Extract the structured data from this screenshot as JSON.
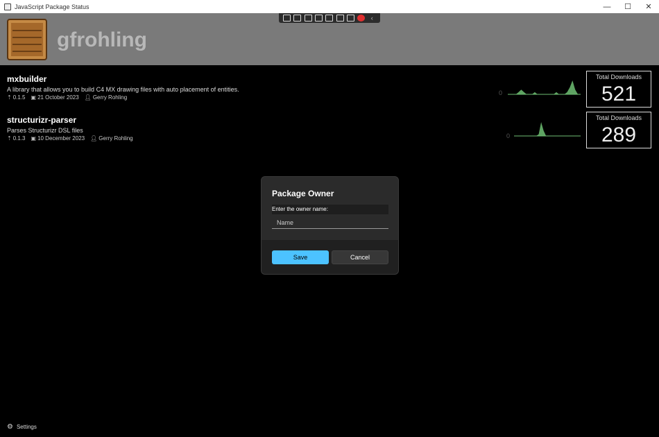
{
  "window": {
    "title": "JavaScript Package Status",
    "controls": [
      "—",
      "☐",
      "✕"
    ]
  },
  "header": {
    "owner": "gfrohling",
    "logo_icon": "crate-icon"
  },
  "packages": [
    {
      "name": "mxbuilder",
      "description": "A library that allows you to build C4 MX drawing files with auto placement of entities.",
      "version": "0.1.5",
      "date": "21 October 2023",
      "author": "Gerry Rohling",
      "downloads_label": "Total Downloads",
      "downloads": "521",
      "spark_zero": "0",
      "spark_values": [
        0,
        0,
        0,
        0,
        1,
        2,
        1,
        0,
        0,
        0,
        1,
        0,
        0,
        0,
        0,
        0,
        0,
        0,
        1,
        0,
        0,
        0,
        1,
        3,
        6,
        2,
        0,
        0
      ]
    },
    {
      "name": "structurizr-parser",
      "description": "Parses Structurizr DSL files",
      "version": "0.1.3",
      "date": "10 December 2023",
      "author": "Gerry Rohling",
      "downloads_label": "Total Downloads",
      "downloads": "289",
      "spark_zero": "0",
      "spark_values": [
        0,
        0,
        0,
        0,
        0,
        0,
        0,
        0,
        0,
        0,
        1,
        8,
        3,
        0,
        0,
        0,
        0,
        0,
        0,
        0,
        0,
        0,
        0,
        0,
        0,
        0,
        0,
        0
      ]
    }
  ],
  "dialog": {
    "title": "Package Owner",
    "prompt": "Enter the owner name:",
    "input_placeholder": "Name",
    "input_value": "",
    "save_label": "Save",
    "cancel_label": "Cancel"
  },
  "footer": {
    "settings_label": "Settings"
  },
  "colors": {
    "accent": "#4cc2ff",
    "spark": "#6fbf73",
    "header_bg": "#7a7a7a"
  }
}
